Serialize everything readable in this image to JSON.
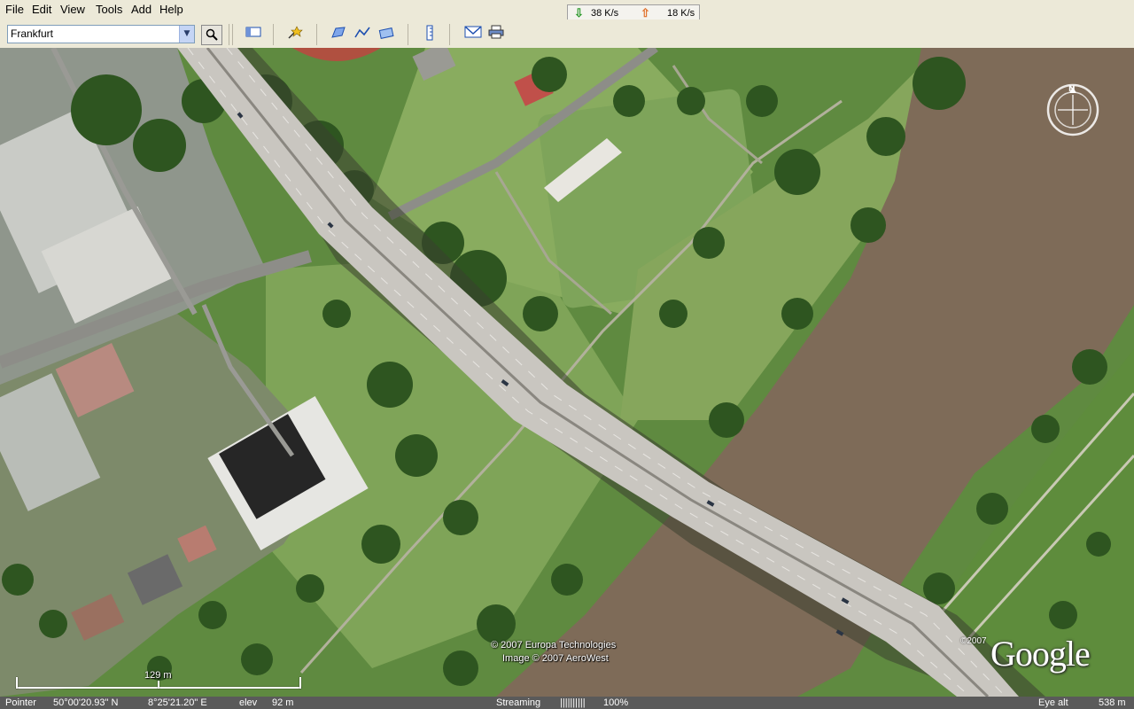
{
  "menu": {
    "items": [
      "File",
      "Edit",
      "View",
      "Tools",
      "Add",
      "Help"
    ]
  },
  "network": {
    "down_label": "38 K/s",
    "up_label": "18 K/s"
  },
  "toolbar": {
    "search_value": "Frankfurt",
    "icons": [
      "search-icon",
      "sidebar-toggle-icon",
      "placemark-icon",
      "polygon-icon",
      "path-icon",
      "image-overlay-icon",
      "ruler-icon",
      "email-icon",
      "print-icon"
    ]
  },
  "map": {
    "copyright_line1": "© 2007 Europa Technologies",
    "copyright_line2": "Image © 2007 AeroWest",
    "logo_year": "©2007",
    "logo_text": "Google",
    "scale_label": "129 m",
    "compass_label": "N"
  },
  "status": {
    "pointer_label": "Pointer",
    "latitude": "50°00'20.93\" N",
    "longitude": "8°25'21.20\" E",
    "elev_label": "elev",
    "elev_value": "92 m",
    "streaming_label": "Streaming",
    "streaming_bar": "||||||||||",
    "streaming_percent": "100%",
    "eye_alt_label": "Eye alt",
    "eye_alt_value": "538 m"
  },
  "colors": {
    "river": "#7e6b58",
    "grass": "#6f9a4a",
    "trees": "#2f5220",
    "bridge": "#c9c6c0",
    "statusbar": "#5a5a5a"
  }
}
